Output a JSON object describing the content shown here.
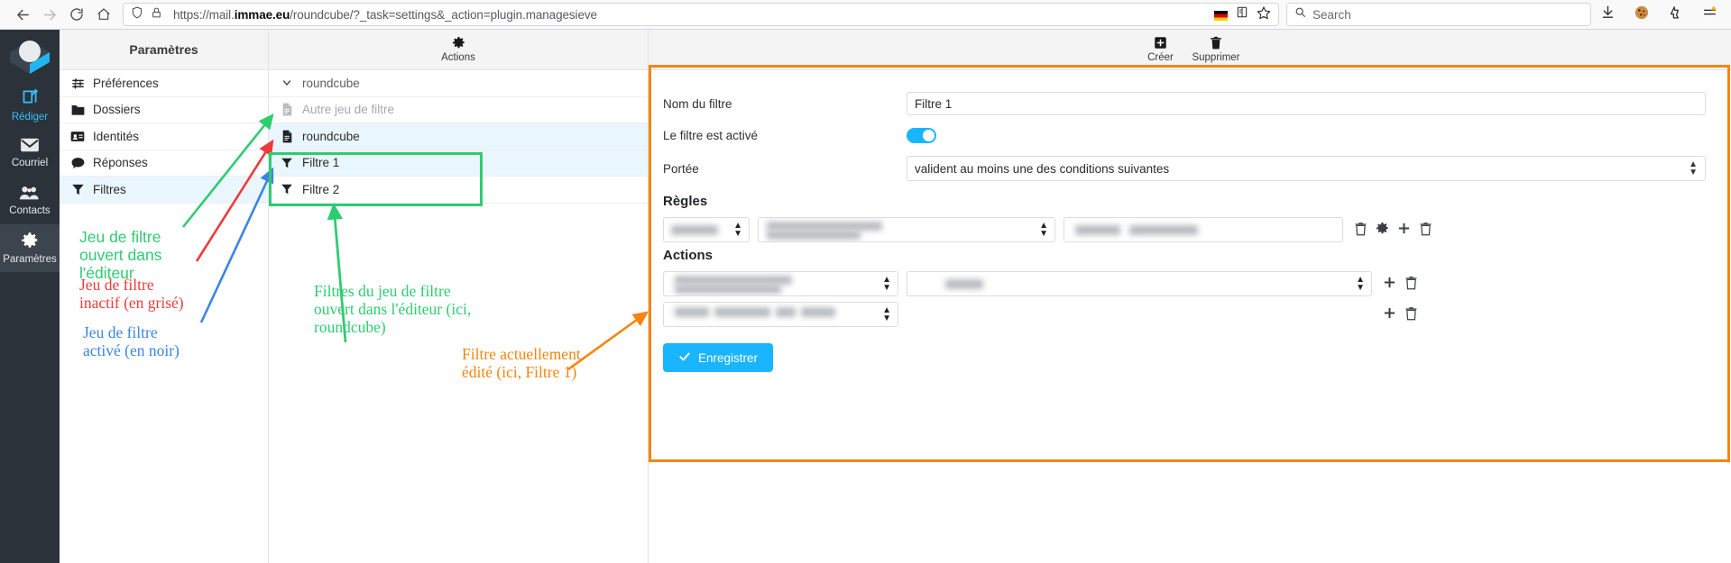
{
  "browser": {
    "back_icon": "arrow-left-icon",
    "forward_icon": "arrow-right-icon",
    "reload_icon": "reload-icon",
    "home_icon": "home-icon",
    "shield_icon": "shield-icon",
    "lock_icon": "padlock-icon",
    "url_prefix": "https://mail.",
    "url_host": "immae.eu",
    "url_suffix": "/roundcube/?_task=settings&_action=plugin.managesieve",
    "flag_icon": "german-flag-icon",
    "reader_icon": "reader-view-icon",
    "bookmark_icon": "star-icon",
    "search_icon": "search-icon",
    "search_placeholder": "Search",
    "downloads_icon": "download-icon",
    "cookie_icon": "cookie-icon",
    "pocket_icon": "pocket-icon",
    "menu_icon": "hamburger-menu-icon"
  },
  "rail": {
    "logo": "roundcube-logo",
    "items": [
      {
        "label": "Rédiger",
        "icon": "compose-icon"
      },
      {
        "label": "Courriel",
        "icon": "envelope-icon"
      },
      {
        "label": "Contacts",
        "icon": "contacts-icon"
      },
      {
        "label": "Paramètres",
        "icon": "gear-icon"
      }
    ]
  },
  "settings": {
    "title": "Paramètres",
    "items": [
      {
        "label": "Préférences",
        "icon": "sliders-icon"
      },
      {
        "label": "Dossiers",
        "icon": "folder-icon"
      },
      {
        "label": "Identités",
        "icon": "id-card-icon"
      },
      {
        "label": "Réponses",
        "icon": "speech-bubble-icon"
      },
      {
        "label": "Filtres",
        "icon": "funnel-icon"
      }
    ]
  },
  "filters_panel": {
    "toolbar": {
      "label": "Actions",
      "icon": "gear-icon"
    },
    "rows": [
      {
        "label": "roundcube",
        "icon": "chevron-down-icon",
        "type": "group"
      },
      {
        "label": "Autre jeu de filtre",
        "icon": "file-icon",
        "type": "inactive"
      },
      {
        "label": "roundcube",
        "icon": "file-icon",
        "type": "selected-set"
      },
      {
        "label": "Filtre 1",
        "icon": "funnel-icon",
        "type": "filter-selected"
      },
      {
        "label": "Filtre 2",
        "icon": "funnel-icon",
        "type": "filter"
      }
    ]
  },
  "form_panel": {
    "toolbar": [
      {
        "label": "Créer",
        "icon": "plus-square-icon"
      },
      {
        "label": "Supprimer",
        "icon": "trash-icon"
      }
    ],
    "fields": {
      "name_label": "Nom du filtre",
      "name_value": "Filtre 1",
      "enabled_label": "Le filtre est activé",
      "enabled_value": "on",
      "scope_label": "Portée",
      "scope_value": "valident au moins une des conditions suivantes"
    },
    "rules_title": "Règles",
    "actions_title": "Actions",
    "row_icons": {
      "trash": "trash-icon",
      "gear": "gear-icon",
      "plus": "plus-icon"
    },
    "save_label": "Enregistrer",
    "save_icon": "check-icon"
  },
  "annotations": {
    "green_left": "Jeu de filtre\nouvert dans\nl'éditeur",
    "red_left": "Jeu de filtre\ninactif (en grisé)",
    "blue_left": "Jeu de filtre\nactivé (en noir)",
    "green_mid": "Filtres du jeu de filtre\nouvert dans l'éditeur (ici,\nroundcube)",
    "orange": "Filtre actuellement\nédité (ici, Filtre 1)",
    "colors": {
      "green": "#2ecc71",
      "red": "#ed3b3b",
      "blue": "#3b84e8",
      "orange": "#f7850d"
    }
  }
}
